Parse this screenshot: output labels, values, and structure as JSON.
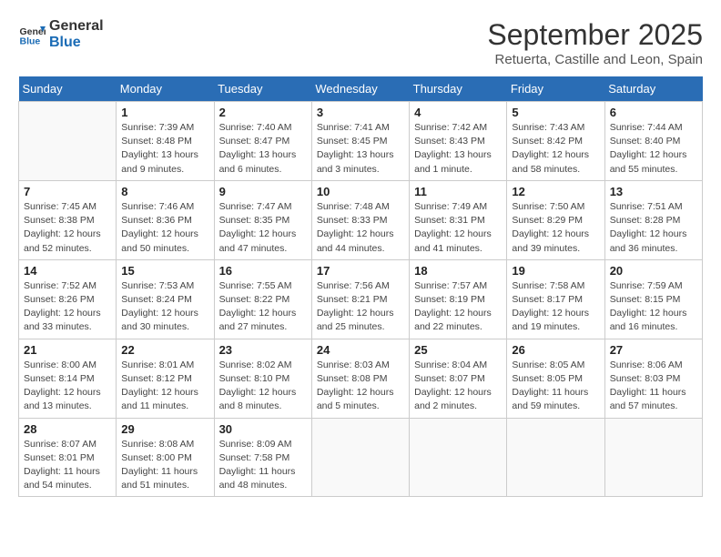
{
  "logo": {
    "line1": "General",
    "line2": "Blue"
  },
  "title": "September 2025",
  "subtitle": "Retuerta, Castille and Leon, Spain",
  "weekdays": [
    "Sunday",
    "Monday",
    "Tuesday",
    "Wednesday",
    "Thursday",
    "Friday",
    "Saturday"
  ],
  "weeks": [
    [
      {
        "day": "",
        "info": ""
      },
      {
        "day": "1",
        "info": "Sunrise: 7:39 AM\nSunset: 8:48 PM\nDaylight: 13 hours\nand 9 minutes."
      },
      {
        "day": "2",
        "info": "Sunrise: 7:40 AM\nSunset: 8:47 PM\nDaylight: 13 hours\nand 6 minutes."
      },
      {
        "day": "3",
        "info": "Sunrise: 7:41 AM\nSunset: 8:45 PM\nDaylight: 13 hours\nand 3 minutes."
      },
      {
        "day": "4",
        "info": "Sunrise: 7:42 AM\nSunset: 8:43 PM\nDaylight: 13 hours\nand 1 minute."
      },
      {
        "day": "5",
        "info": "Sunrise: 7:43 AM\nSunset: 8:42 PM\nDaylight: 12 hours\nand 58 minutes."
      },
      {
        "day": "6",
        "info": "Sunrise: 7:44 AM\nSunset: 8:40 PM\nDaylight: 12 hours\nand 55 minutes."
      }
    ],
    [
      {
        "day": "7",
        "info": "Sunrise: 7:45 AM\nSunset: 8:38 PM\nDaylight: 12 hours\nand 52 minutes."
      },
      {
        "day": "8",
        "info": "Sunrise: 7:46 AM\nSunset: 8:36 PM\nDaylight: 12 hours\nand 50 minutes."
      },
      {
        "day": "9",
        "info": "Sunrise: 7:47 AM\nSunset: 8:35 PM\nDaylight: 12 hours\nand 47 minutes."
      },
      {
        "day": "10",
        "info": "Sunrise: 7:48 AM\nSunset: 8:33 PM\nDaylight: 12 hours\nand 44 minutes."
      },
      {
        "day": "11",
        "info": "Sunrise: 7:49 AM\nSunset: 8:31 PM\nDaylight: 12 hours\nand 41 minutes."
      },
      {
        "day": "12",
        "info": "Sunrise: 7:50 AM\nSunset: 8:29 PM\nDaylight: 12 hours\nand 39 minutes."
      },
      {
        "day": "13",
        "info": "Sunrise: 7:51 AM\nSunset: 8:28 PM\nDaylight: 12 hours\nand 36 minutes."
      }
    ],
    [
      {
        "day": "14",
        "info": "Sunrise: 7:52 AM\nSunset: 8:26 PM\nDaylight: 12 hours\nand 33 minutes."
      },
      {
        "day": "15",
        "info": "Sunrise: 7:53 AM\nSunset: 8:24 PM\nDaylight: 12 hours\nand 30 minutes."
      },
      {
        "day": "16",
        "info": "Sunrise: 7:55 AM\nSunset: 8:22 PM\nDaylight: 12 hours\nand 27 minutes."
      },
      {
        "day": "17",
        "info": "Sunrise: 7:56 AM\nSunset: 8:21 PM\nDaylight: 12 hours\nand 25 minutes."
      },
      {
        "day": "18",
        "info": "Sunrise: 7:57 AM\nSunset: 8:19 PM\nDaylight: 12 hours\nand 22 minutes."
      },
      {
        "day": "19",
        "info": "Sunrise: 7:58 AM\nSunset: 8:17 PM\nDaylight: 12 hours\nand 19 minutes."
      },
      {
        "day": "20",
        "info": "Sunrise: 7:59 AM\nSunset: 8:15 PM\nDaylight: 12 hours\nand 16 minutes."
      }
    ],
    [
      {
        "day": "21",
        "info": "Sunrise: 8:00 AM\nSunset: 8:14 PM\nDaylight: 12 hours\nand 13 minutes."
      },
      {
        "day": "22",
        "info": "Sunrise: 8:01 AM\nSunset: 8:12 PM\nDaylight: 12 hours\nand 11 minutes."
      },
      {
        "day": "23",
        "info": "Sunrise: 8:02 AM\nSunset: 8:10 PM\nDaylight: 12 hours\nand 8 minutes."
      },
      {
        "day": "24",
        "info": "Sunrise: 8:03 AM\nSunset: 8:08 PM\nDaylight: 12 hours\nand 5 minutes."
      },
      {
        "day": "25",
        "info": "Sunrise: 8:04 AM\nSunset: 8:07 PM\nDaylight: 12 hours\nand 2 minutes."
      },
      {
        "day": "26",
        "info": "Sunrise: 8:05 AM\nSunset: 8:05 PM\nDaylight: 11 hours\nand 59 minutes."
      },
      {
        "day": "27",
        "info": "Sunrise: 8:06 AM\nSunset: 8:03 PM\nDaylight: 11 hours\nand 57 minutes."
      }
    ],
    [
      {
        "day": "28",
        "info": "Sunrise: 8:07 AM\nSunset: 8:01 PM\nDaylight: 11 hours\nand 54 minutes."
      },
      {
        "day": "29",
        "info": "Sunrise: 8:08 AM\nSunset: 8:00 PM\nDaylight: 11 hours\nand 51 minutes."
      },
      {
        "day": "30",
        "info": "Sunrise: 8:09 AM\nSunset: 7:58 PM\nDaylight: 11 hours\nand 48 minutes."
      },
      {
        "day": "",
        "info": ""
      },
      {
        "day": "",
        "info": ""
      },
      {
        "day": "",
        "info": ""
      },
      {
        "day": "",
        "info": ""
      }
    ]
  ]
}
